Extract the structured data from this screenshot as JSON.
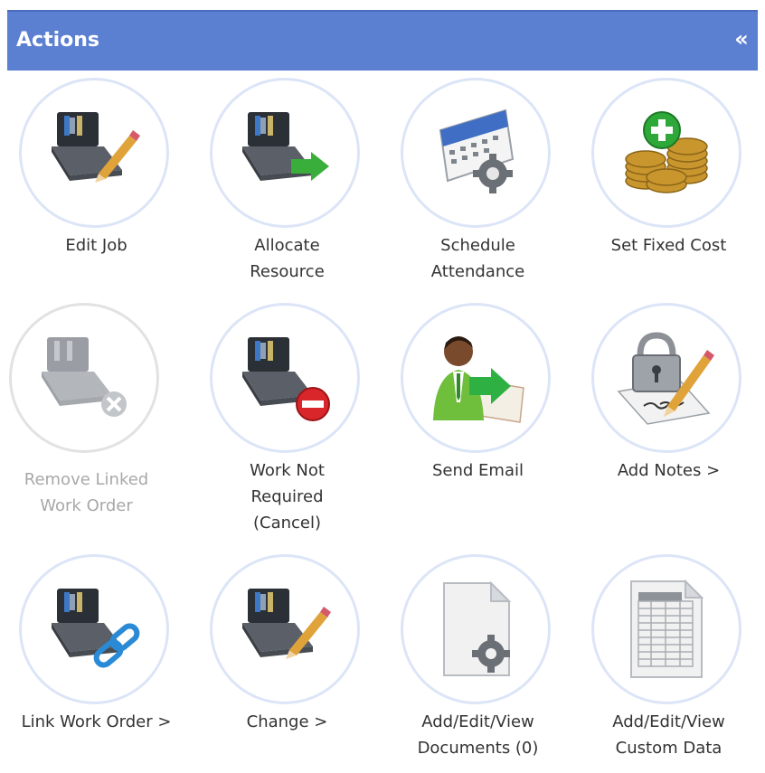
{
  "header": {
    "title": "Actions",
    "collapse_glyph": "«"
  },
  "actions": [
    {
      "label": "Edit Job",
      "icon": "toolbox-pencil-icon",
      "enabled": true
    },
    {
      "label": "Allocate Resource",
      "icon": "toolbox-arrow-icon",
      "enabled": true
    },
    {
      "label": "Schedule Attendance",
      "icon": "calendar-gear-icon",
      "enabled": true
    },
    {
      "label": "Set Fixed Cost",
      "icon": "coins-plus-icon",
      "enabled": true
    },
    {
      "label": "Remove Linked Work Order",
      "icon": "toolbox-remove-icon",
      "enabled": false
    },
    {
      "label": "Work Not Required (Cancel)",
      "icon": "toolbox-cancel-icon",
      "enabled": true
    },
    {
      "label": "Send Email",
      "icon": "person-email-icon",
      "enabled": true
    },
    {
      "label": "Add Notes >",
      "icon": "lock-pencil-icon",
      "enabled": true
    },
    {
      "label": "Link Work Order >",
      "icon": "toolbox-link-icon",
      "enabled": true
    },
    {
      "label": "Change >",
      "icon": "toolbox-pencil-icon",
      "enabled": true
    },
    {
      "label": "Add/Edit/View Documents (0)",
      "icon": "document-gear-icon",
      "enabled": true
    },
    {
      "label": "Add/Edit/View Custom Data",
      "icon": "spreadsheet-icon",
      "enabled": true
    }
  ],
  "colors": {
    "header": "#5b7fd1",
    "circle_border": "#dce5f7",
    "label": "#333333",
    "disabled_label": "#a8a8a8"
  }
}
